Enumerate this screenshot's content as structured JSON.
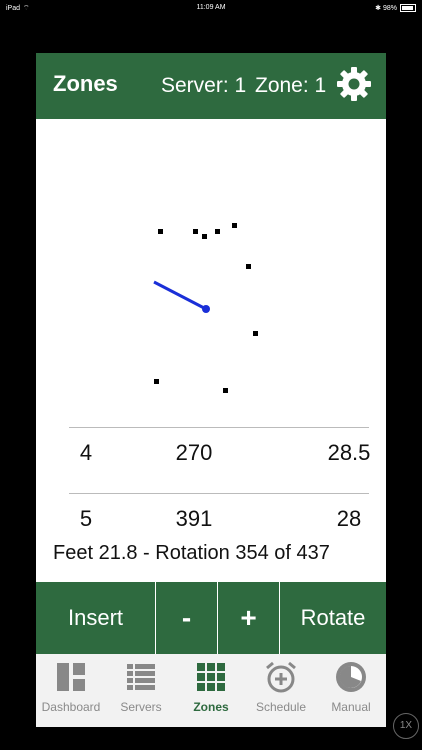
{
  "status_bar": {
    "left": "iPad",
    "time": "11:09 AM",
    "battery": "98%"
  },
  "header": {
    "title": "Zones",
    "server": "Server: 1",
    "zone": "Zone: 1"
  },
  "rows": [
    {
      "col1": "4",
      "col2": "270",
      "col3": "28.5"
    },
    {
      "col1": "5",
      "col2": "391",
      "col3": "28"
    }
  ],
  "status_text": "Feet 21.8 - Rotation 354 of 437",
  "actions": {
    "insert": "Insert",
    "minus": "-",
    "plus": "+",
    "rotate": "Rotate"
  },
  "tabs": [
    {
      "label": "Dashboard",
      "icon": "dashboard-icon"
    },
    {
      "label": "Servers",
      "icon": "servers-icon"
    },
    {
      "label": "Zones",
      "icon": "zones-grid-icon",
      "active": true
    },
    {
      "label": "Schedule",
      "icon": "alarm-clock-icon"
    },
    {
      "label": "Manual",
      "icon": "manual-dial-icon"
    }
  ],
  "zoom_indicator": "1X",
  "colors": {
    "brand": "#2e6a3f",
    "line": "#1a2fd8"
  }
}
